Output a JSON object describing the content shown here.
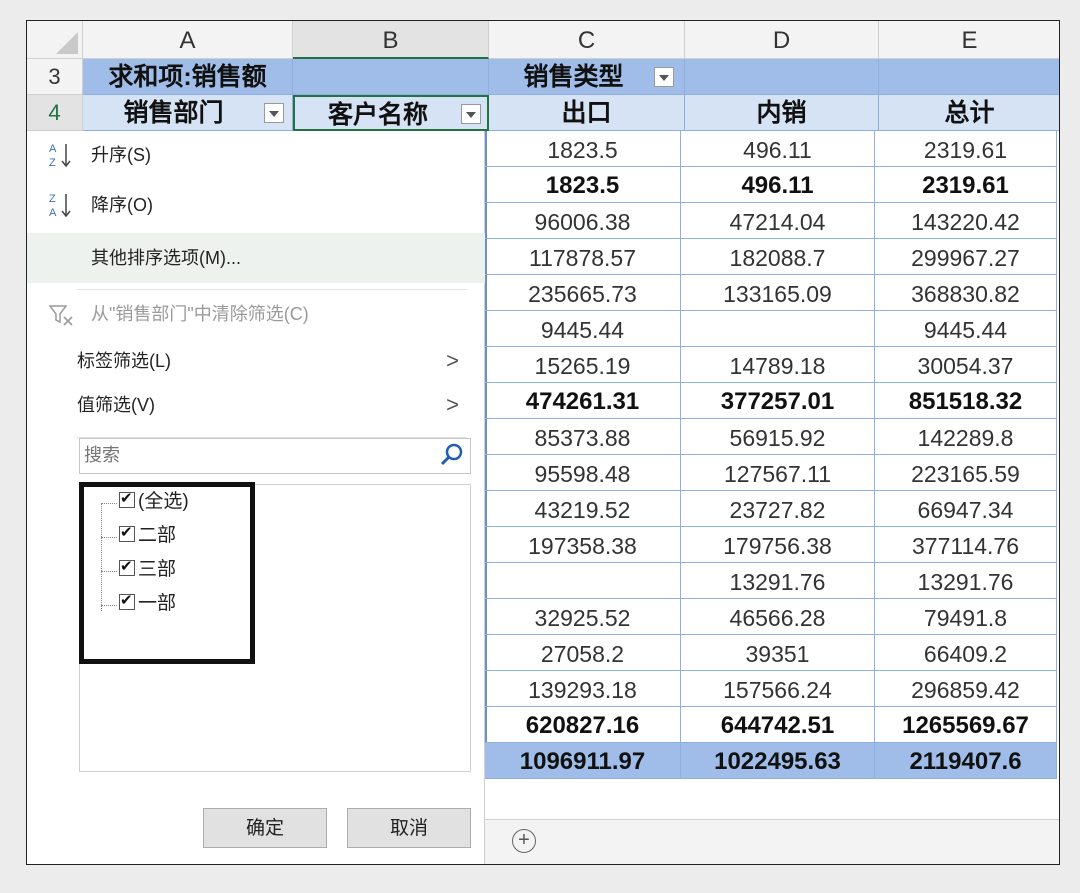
{
  "columns": {
    "A": "A",
    "B": "B",
    "C": "C",
    "D": "D",
    "E": "E"
  },
  "rows": {
    "r3": "3",
    "r4": "4"
  },
  "pivot": {
    "sum_label": "求和项:销售额",
    "col_field": "销售类型",
    "row_field_1": "销售部门",
    "row_field_2": "客户名称",
    "col_1": "出口",
    "col_2": "内销",
    "col_3": "总计"
  },
  "data_rows": [
    {
      "c": "1823.5",
      "d": "496.11",
      "e": "2319.61",
      "style": "normal"
    },
    {
      "c": "1823.5",
      "d": "496.11",
      "e": "2319.61",
      "style": "bold"
    },
    {
      "c": "96006.38",
      "d": "47214.04",
      "e": "143220.42",
      "style": "normal"
    },
    {
      "c": "117878.57",
      "d": "182088.7",
      "e": "299967.27",
      "style": "normal"
    },
    {
      "c": "235665.73",
      "d": "133165.09",
      "e": "368830.82",
      "style": "normal"
    },
    {
      "c": "9445.44",
      "d": "",
      "e": "9445.44",
      "style": "normal"
    },
    {
      "c": "15265.19",
      "d": "14789.18",
      "e": "30054.37",
      "style": "normal"
    },
    {
      "c": "474261.31",
      "d": "377257.01",
      "e": "851518.32",
      "style": "bold"
    },
    {
      "c": "85373.88",
      "d": "56915.92",
      "e": "142289.8",
      "style": "normal"
    },
    {
      "c": "95598.48",
      "d": "127567.11",
      "e": "223165.59",
      "style": "normal"
    },
    {
      "c": "43219.52",
      "d": "23727.82",
      "e": "66947.34",
      "style": "normal"
    },
    {
      "c": "197358.38",
      "d": "179756.38",
      "e": "377114.76",
      "style": "normal"
    },
    {
      "c": "",
      "d": "13291.76",
      "e": "13291.76",
      "style": "normal"
    },
    {
      "c": "32925.52",
      "d": "46566.28",
      "e": "79491.8",
      "style": "normal"
    },
    {
      "c": "27058.2",
      "d": "39351",
      "e": "66409.2",
      "style": "normal"
    },
    {
      "c": "139293.18",
      "d": "157566.24",
      "e": "296859.42",
      "style": "normal"
    },
    {
      "c": "620827.16",
      "d": "644742.51",
      "e": "1265569.67",
      "style": "bold"
    },
    {
      "c": "1096911.97",
      "d": "1022495.63",
      "e": "2119407.6",
      "style": "total"
    }
  ],
  "menu": {
    "sort_asc": "升序(S)",
    "sort_desc": "降序(O)",
    "more_sort": "其他排序选项(M)...",
    "clear_filter": "从\"销售部门\"中清除筛选(C)",
    "label_filter": "标签筛选(L)",
    "value_filter": "值筛选(V)",
    "submenu_arrow": ">",
    "search_placeholder": "搜索",
    "items": [
      "(全选)",
      "二部",
      "三部",
      "一部"
    ],
    "ok": "确定",
    "cancel": "取消"
  },
  "icons": {
    "sort_asc": "sort-ascending-icon",
    "sort_desc": "sort-descending-icon",
    "clear_filter": "clear-filter-icon",
    "search": "search-icon",
    "add_sheet": "add-sheet-icon"
  },
  "add_sheet_symbol": "+"
}
